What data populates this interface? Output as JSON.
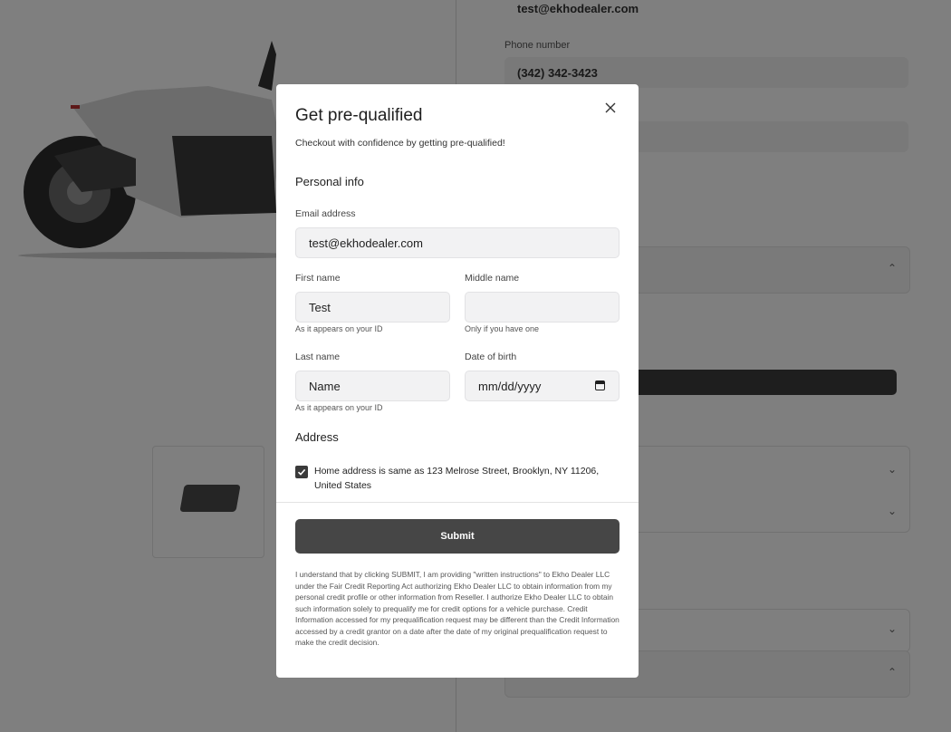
{
  "background": {
    "right_column": {
      "email_value": "test@ekhodealer.com",
      "phone_label": "Phone number",
      "phone_value": "(342) 342-3423"
    }
  },
  "modal": {
    "title": "Get pre-qualified",
    "subtitle": "Checkout with confidence by getting pre-qualified!",
    "personal_info_heading": "Personal info",
    "email": {
      "label": "Email address",
      "value": "test@ekhodealer.com"
    },
    "first_name": {
      "label": "First name",
      "value": "Test",
      "help": "As it appears on your ID"
    },
    "middle_name": {
      "label": "Middle name",
      "value": "",
      "help": "Only if you have one"
    },
    "last_name": {
      "label": "Last name",
      "value": "Name",
      "help": "As it appears on your ID"
    },
    "date_of_birth": {
      "label": "Date of birth",
      "placeholder": "mm/dd/yyyy"
    },
    "address_heading": "Address",
    "address_checkbox": {
      "checked": true,
      "label": "Home address is same as 123 Melrose Street, Brooklyn, NY 11206, United States"
    },
    "submit_label": "Submit",
    "disclaimer": "I understand that by clicking SUBMIT, I am providing \"written instructions\" to Ekho Dealer LLC under the Fair Credit Reporting Act authorizing Ekho Dealer LLC to obtain information from my personal credit profile or other information from Reseller. I authorize Ekho Dealer LLC to obtain such information solely to prequalify me for credit options for a vehicle purchase. Credit Information accessed for my prequalification request may be different than the Credit Information accessed by a credit grantor on a date after the date of my original prequalification request to make the credit decision."
  },
  "colors": {
    "overlay": "rgba(0,0,0,0.5)",
    "submit_bg": "#464646",
    "input_bg": "#f2f2f3",
    "checkbox_bg": "#3a3a3a"
  },
  "icons": {
    "close": "close-icon",
    "calendar": "calendar-icon",
    "checkmark": "checkmark-icon"
  }
}
